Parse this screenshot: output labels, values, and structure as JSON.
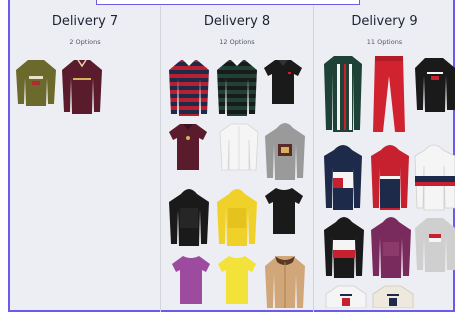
{
  "columns": [
    {
      "title": "Delivery 7",
      "subtitle": "2 Options"
    },
    {
      "title": "Delivery 8",
      "subtitle": "12 Options"
    },
    {
      "title": "Delivery 9",
      "subtitle": "11 Options"
    }
  ],
  "colors": {
    "accent": "#6b5ce7",
    "olive": "#6b6a2c",
    "burgundy": "#5a1b2c",
    "red": "#c7202f",
    "navy": "#1d2a4a",
    "green": "#1f4236",
    "black": "#1a1a1a",
    "white": "#f5f5f5",
    "grey": "#9a9a9a",
    "yellow": "#f0d12a",
    "purple": "#9d4b9e",
    "tan": "#d1a77a"
  }
}
